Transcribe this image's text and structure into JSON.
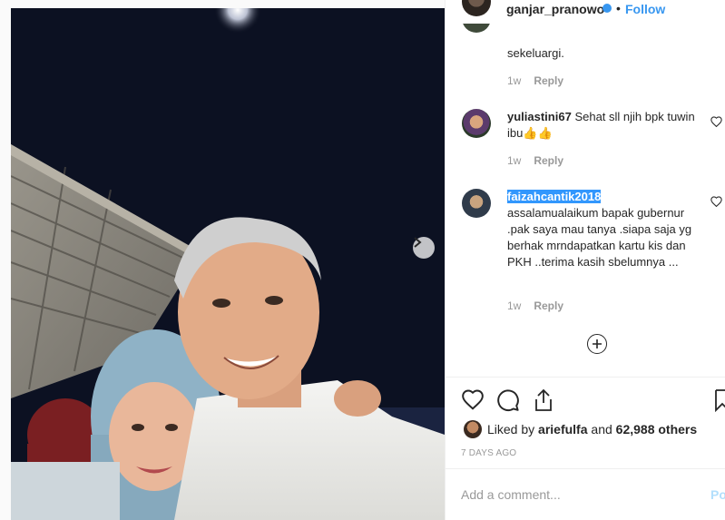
{
  "header": {
    "username": "ganjar_pranowo",
    "separator": "•",
    "follow_label": "Follow"
  },
  "comments": [
    {
      "text": "sekeluargi.",
      "time": "1w",
      "reply_label": "Reply"
    },
    {
      "username": "yuliastini67",
      "text": "Sehat sll njih bpk tuwin ibu👍👍",
      "time": "1w",
      "reply_label": "Reply"
    },
    {
      "username": "faizahcantik2018",
      "text": "assalamualaikum bapak gubernur .pak saya mau tanya .siapa saja yg berhak mrndapatkan kartu kis dan PKH ..terima kasih sbelumnya ...",
      "time": "1w",
      "reply_label": "Reply"
    }
  ],
  "likes": {
    "prefix": "Liked by",
    "user": "ariefulfa",
    "connector": "and",
    "others": "62,988 others"
  },
  "post_date": "7 DAYS AGO",
  "comment_box": {
    "placeholder": "Add a comment...",
    "post_label": "Post"
  },
  "icons": {
    "verified": "verified-badge-icon",
    "like": "heart-icon",
    "comment": "comment-bubble-icon",
    "share": "share-icon",
    "save": "bookmark-icon",
    "load_more": "plus-circle-icon",
    "next": "chevron-right-icon"
  },
  "colors": {
    "link_blue": "#3897f0",
    "selection": "#3297fd",
    "muted": "#999999",
    "text": "#262626"
  }
}
